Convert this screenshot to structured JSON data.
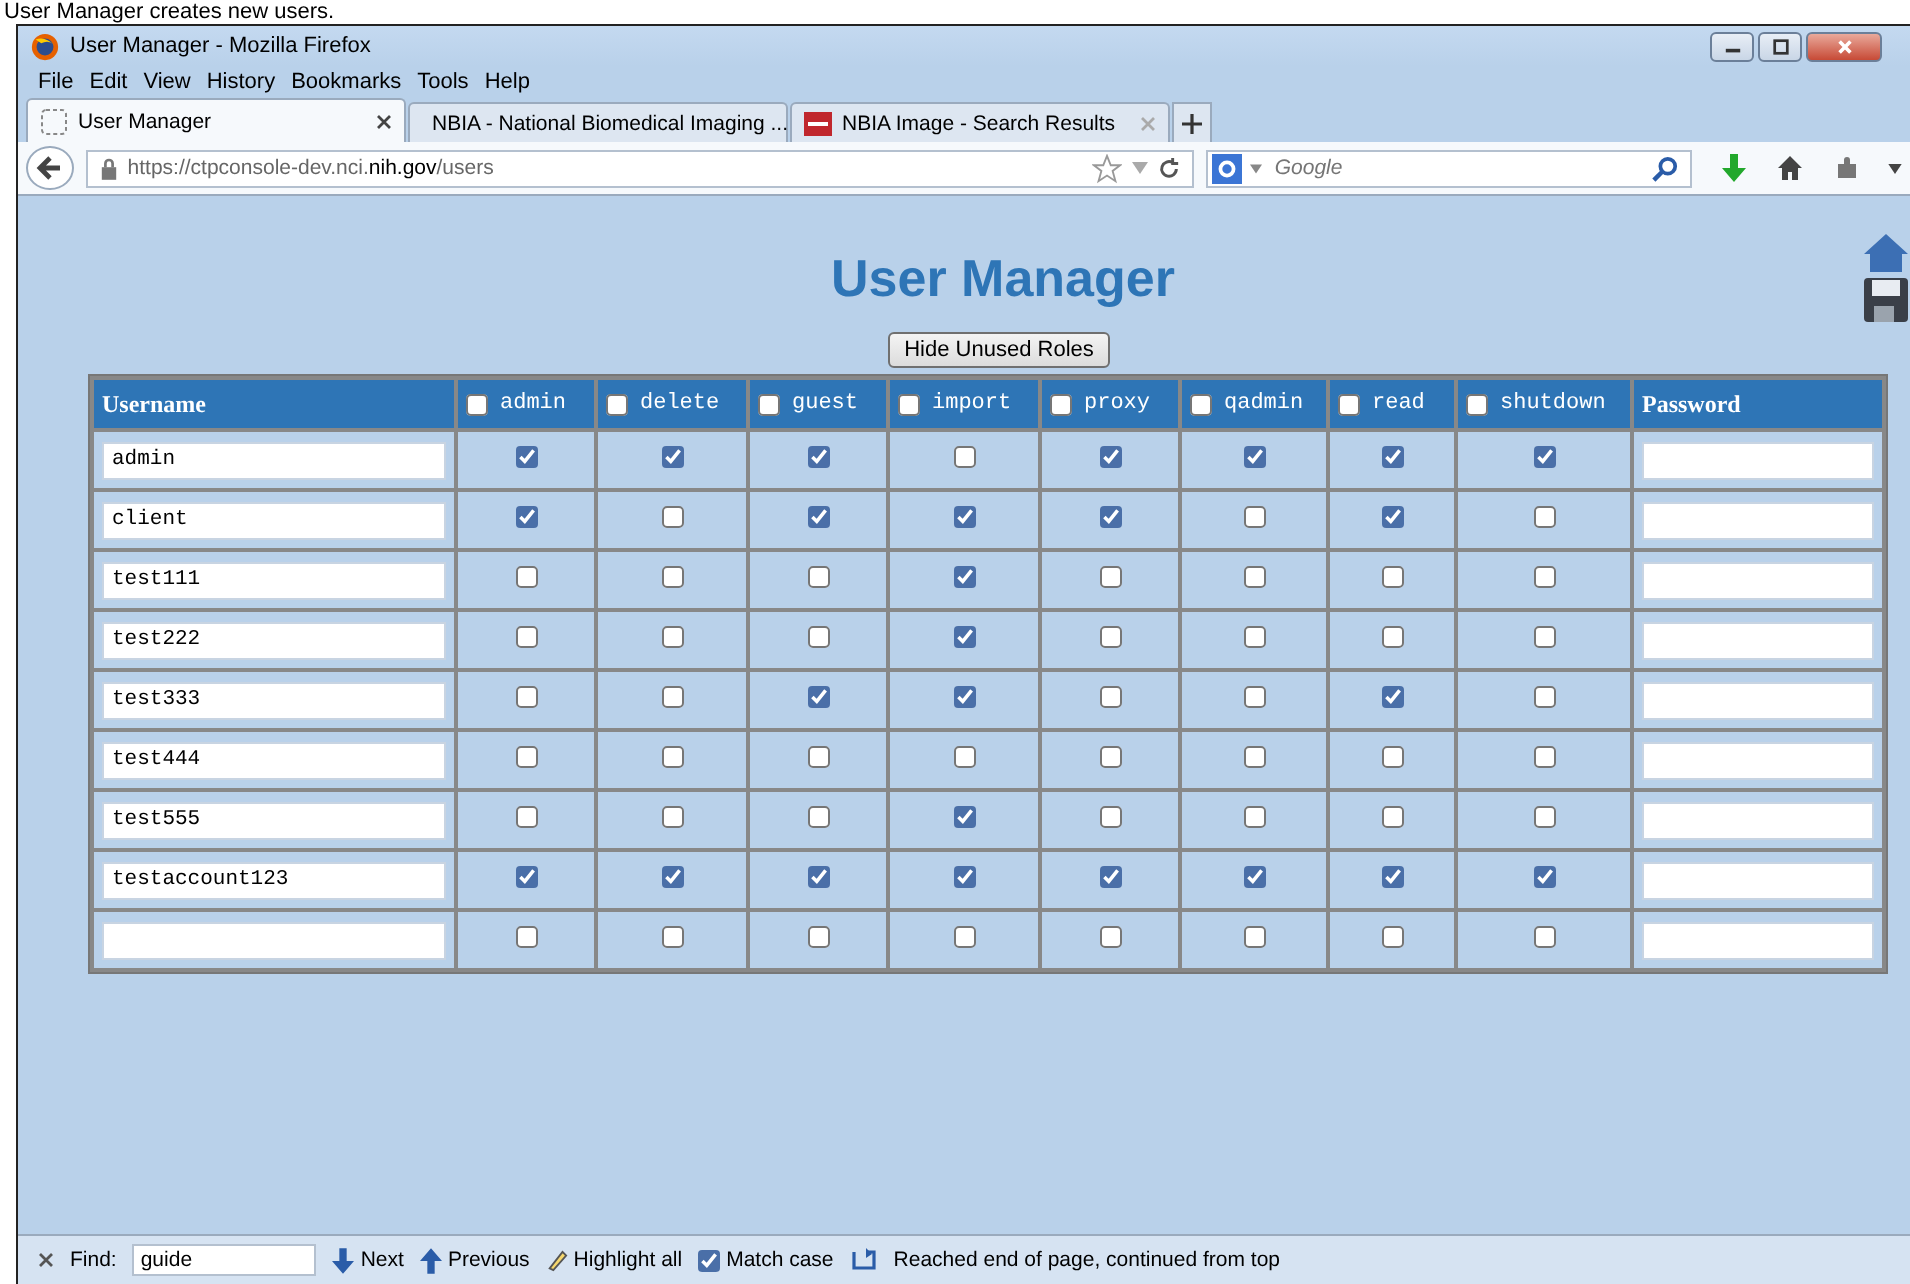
{
  "caption": "User Manager creates new users.",
  "window": {
    "title": "User Manager - Mozilla Firefox"
  },
  "menu": [
    "File",
    "Edit",
    "View",
    "History",
    "Bookmarks",
    "Tools",
    "Help"
  ],
  "tabs": [
    {
      "label": "User Manager",
      "selected": true,
      "kind": "blank"
    },
    {
      "label": "NBIA - National Biomedical Imaging ...",
      "selected": false,
      "kind": "site"
    },
    {
      "label": "NBIA Image - Search Results",
      "selected": false,
      "kind": "site"
    }
  ],
  "address_bar": {
    "url": "https://ctpconsole-dev.nci.**nih.gov**/users"
  },
  "search": {
    "placeholder": "Google"
  },
  "page": {
    "heading": "User Manager",
    "hide_button": "Hide Unused Roles",
    "table": {
      "username_header": "Username",
      "password_header": "Password",
      "roles": [
        {
          "label": "admin",
          "checked": false
        },
        {
          "label": "delete",
          "checked": false
        },
        {
          "label": "guest",
          "checked": false
        },
        {
          "label": "import",
          "checked": false
        },
        {
          "label": "proxy",
          "checked": false
        },
        {
          "label": "qadmin",
          "checked": false
        },
        {
          "label": "read",
          "checked": false
        },
        {
          "label": "shutdown",
          "checked": false
        }
      ],
      "rows": [
        {
          "username": "admin",
          "roles": [
            true,
            true,
            true,
            false,
            true,
            true,
            true,
            true
          ]
        },
        {
          "username": "client",
          "roles": [
            true,
            false,
            true,
            true,
            true,
            false,
            true,
            false
          ]
        },
        {
          "username": "test111",
          "roles": [
            false,
            false,
            false,
            true,
            false,
            false,
            false,
            false
          ]
        },
        {
          "username": "test222",
          "roles": [
            false,
            false,
            false,
            true,
            false,
            false,
            false,
            false
          ]
        },
        {
          "username": "test333",
          "roles": [
            false,
            false,
            true,
            true,
            false,
            false,
            true,
            false
          ]
        },
        {
          "username": "test444",
          "roles": [
            false,
            false,
            false,
            false,
            false,
            false,
            false,
            false
          ]
        },
        {
          "username": "test555",
          "roles": [
            false,
            false,
            false,
            true,
            false,
            false,
            false,
            false
          ]
        },
        {
          "username": "testaccount123",
          "roles": [
            true,
            true,
            true,
            true,
            true,
            true,
            true,
            true
          ]
        },
        {
          "roles": [
            false,
            false,
            false,
            false,
            false,
            false,
            false,
            false
          ]
        }
      ]
    }
  },
  "find_bar": {
    "label": "Find:",
    "value": "guide",
    "next": "Next",
    "previous": "Previous",
    "highlight_all": "Highlight all",
    "match_case": {
      "label": "Match case",
      "checked": true
    },
    "status": "Reached end of page, continued from top"
  }
}
